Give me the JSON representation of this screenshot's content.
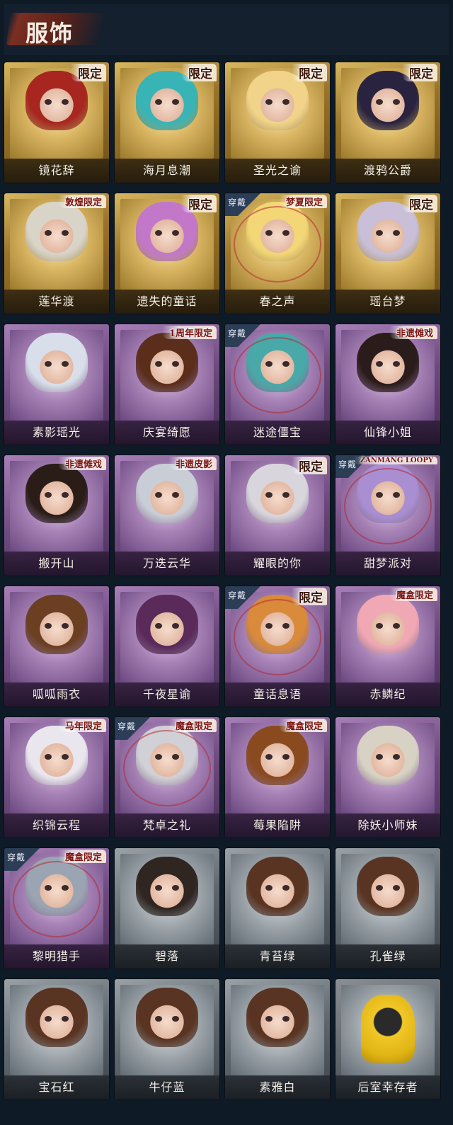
{
  "header": {
    "title": "服饰"
  },
  "worn_label": "穿戴",
  "costumes": [
    {
      "name": "镜花辞",
      "rarity": "gold",
      "badge": "限定",
      "worn": false,
      "hair": "#a7261f"
    },
    {
      "name": "海月息潮",
      "rarity": "gold",
      "badge": "限定",
      "worn": false,
      "hair": "#39b4b6"
    },
    {
      "name": "圣光之谕",
      "rarity": "gold",
      "badge": "限定",
      "worn": false,
      "hair": "#f1d48a"
    },
    {
      "name": "渡鸦公爵",
      "rarity": "gold",
      "badge": "限定",
      "worn": false,
      "hair": "#2a2340"
    },
    {
      "name": "莲华渡",
      "rarity": "gold",
      "badge": "敦煌限定",
      "worn": false,
      "hair": "#d9d4c8"
    },
    {
      "name": "遗失的童话",
      "rarity": "gold",
      "badge": "限定",
      "worn": false,
      "hair": "#c377c9"
    },
    {
      "name": "春之声",
      "rarity": "gold",
      "badge": "梦夏限定",
      "worn": true,
      "hair": "#f3d675"
    },
    {
      "name": "瑶台梦",
      "rarity": "gold",
      "badge": "限定",
      "worn": false,
      "hair": "#c9bfd8"
    },
    {
      "name": "素影瑶光",
      "rarity": "purple",
      "badge": "",
      "worn": false,
      "hair": "#d8dfea"
    },
    {
      "name": "庆宴绮愿",
      "rarity": "purple",
      "badge": "1周年限定",
      "worn": false,
      "hair": "#5b2e1c"
    },
    {
      "name": "迷途僵宝",
      "rarity": "purple",
      "badge": "",
      "worn": true,
      "hair": "#49a8a8"
    },
    {
      "name": "仙锋小姐",
      "rarity": "purple",
      "badge": "非遗傩戏",
      "worn": false,
      "hair": "#2b1c1c"
    },
    {
      "name": "搬开山",
      "rarity": "purple",
      "badge": "非遗傩戏",
      "worn": false,
      "hair": "#2a1d18"
    },
    {
      "name": "万迭云华",
      "rarity": "purple",
      "badge": "非遗皮影",
      "worn": false,
      "hair": "#c8cdd6"
    },
    {
      "name": "耀眼的你",
      "rarity": "purple",
      "badge": "限定",
      "worn": false,
      "hair": "#d8d6dc"
    },
    {
      "name": "甜梦派对",
      "rarity": "purple",
      "badge": "ZANMANG LOOPY",
      "worn": true,
      "hair": "#a98fd2"
    },
    {
      "name": "呱呱雨衣",
      "rarity": "purple",
      "badge": "",
      "worn": false,
      "hair": "#6b3f22"
    },
    {
      "name": "千夜星谕",
      "rarity": "purple",
      "badge": "",
      "worn": false,
      "hair": "#5a2a5a"
    },
    {
      "name": "童话息语",
      "rarity": "purple",
      "badge": "限定",
      "worn": true,
      "hair": "#d98a3a"
    },
    {
      "name": "赤鳞纪",
      "rarity": "purple",
      "badge": "魔盒限定",
      "worn": false,
      "hair": "#f0a8b4"
    },
    {
      "name": "织锦云程",
      "rarity": "purple",
      "badge": "马年限定",
      "worn": false,
      "hair": "#e9e6ee"
    },
    {
      "name": "梵卓之礼",
      "rarity": "purple",
      "badge": "魔盒限定",
      "worn": true,
      "hair": "#d0d0d6"
    },
    {
      "name": "莓果陷阱",
      "rarity": "purple",
      "badge": "魔盒限定",
      "worn": false,
      "hair": "#8a4a20"
    },
    {
      "name": "除妖小师妹",
      "rarity": "purple",
      "badge": "",
      "worn": false,
      "hair": "#d8d2c4"
    },
    {
      "name": "黎明猎手",
      "rarity": "purple",
      "badge": "魔盒限定",
      "worn": true,
      "hair": "#9aa4b2"
    },
    {
      "name": "碧落",
      "rarity": "grey",
      "badge": "",
      "worn": false,
      "hair": "#2f2622"
    },
    {
      "name": "青苔绿",
      "rarity": "grey",
      "badge": "",
      "worn": false,
      "hair": "#5a3422"
    },
    {
      "name": "孔雀绿",
      "rarity": "grey",
      "badge": "",
      "worn": false,
      "hair": "#5a3422"
    },
    {
      "name": "宝石红",
      "rarity": "grey",
      "badge": "",
      "worn": false,
      "hair": "#5a3422"
    },
    {
      "name": "牛仔蓝",
      "rarity": "grey",
      "badge": "",
      "worn": false,
      "hair": "#5a3422"
    },
    {
      "name": "素雅白",
      "rarity": "grey",
      "badge": "",
      "worn": false,
      "hair": "#5a3422"
    },
    {
      "name": "后室幸存者",
      "rarity": "yellow",
      "badge": "",
      "worn": false,
      "hair": "#f0c828"
    }
  ]
}
